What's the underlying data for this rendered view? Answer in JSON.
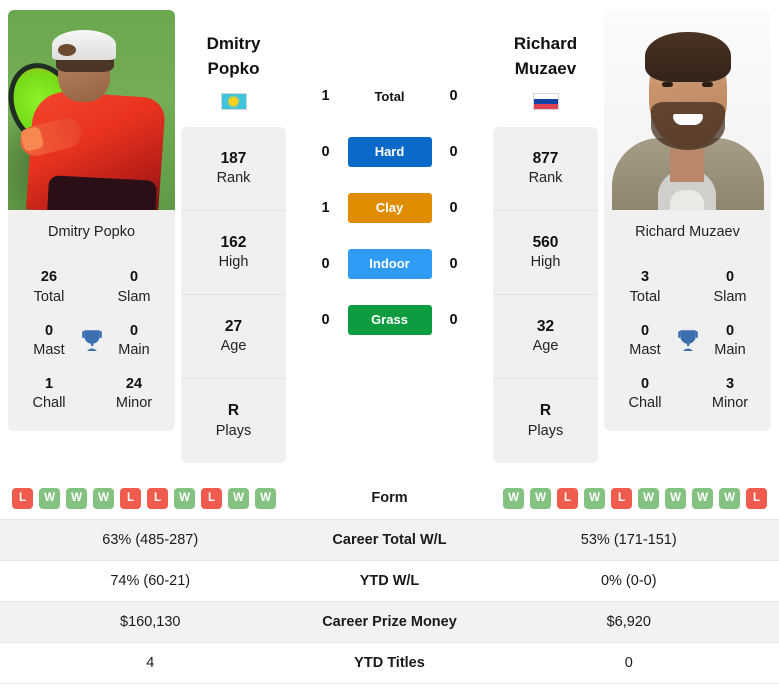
{
  "players": {
    "left": {
      "first_name": "Dmitry",
      "last_name": "Popko",
      "photo_caption": "Dmitry Popko",
      "country_code": "KZ",
      "flag_icon": "kazakhstan-flag-icon",
      "stats": [
        {
          "value": "187",
          "label": "Rank"
        },
        {
          "value": "162",
          "label": "High"
        },
        {
          "value": "27",
          "label": "Age"
        },
        {
          "value": "R",
          "label": "Plays"
        }
      ],
      "titles": [
        {
          "value": "26",
          "label": "Total"
        },
        {
          "value": "0",
          "label": "Slam"
        },
        {
          "value": "0",
          "label": "Mast"
        },
        {
          "value": "0",
          "label": "Main"
        },
        {
          "value": "1",
          "label": "Chall"
        },
        {
          "value": "24",
          "label": "Minor"
        }
      ],
      "form": [
        "L",
        "W",
        "W",
        "W",
        "L",
        "L",
        "W",
        "L",
        "W",
        "W"
      ],
      "career_total_wl": "63% (485-287)",
      "ytd_wl": "74% (60-21)",
      "career_prize_money": "$160,130",
      "ytd_titles": "4"
    },
    "right": {
      "first_name": "Richard",
      "last_name": "Muzaev",
      "photo_caption": "Richard Muzaev",
      "country_code": "RU",
      "flag_icon": "russia-flag-icon",
      "stats": [
        {
          "value": "877",
          "label": "Rank"
        },
        {
          "value": "560",
          "label": "High"
        },
        {
          "value": "32",
          "label": "Age"
        },
        {
          "value": "R",
          "label": "Plays"
        }
      ],
      "titles": [
        {
          "value": "3",
          "label": "Total"
        },
        {
          "value": "0",
          "label": "Slam"
        },
        {
          "value": "0",
          "label": "Mast"
        },
        {
          "value": "0",
          "label": "Main"
        },
        {
          "value": "0",
          "label": "Chall"
        },
        {
          "value": "3",
          "label": "Minor"
        }
      ],
      "form": [
        "W",
        "W",
        "L",
        "W",
        "L",
        "W",
        "W",
        "W",
        "W",
        "L"
      ],
      "career_total_wl": "53% (171-151)",
      "ytd_wl": "0% (0-0)",
      "career_prize_money": "$6,920",
      "ytd_titles": "0"
    }
  },
  "head_to_head": [
    {
      "label": "Total",
      "left": "1",
      "right": "0",
      "style": "plain",
      "color": ""
    },
    {
      "label": "Hard",
      "left": "0",
      "right": "0",
      "style": "badge",
      "color": "#0b69c7"
    },
    {
      "label": "Clay",
      "left": "1",
      "right": "0",
      "style": "badge",
      "color": "#e08c00"
    },
    {
      "label": "Indoor",
      "left": "0",
      "right": "0",
      "style": "badge",
      "color": "#2f9bf5"
    },
    {
      "label": "Grass",
      "left": "0",
      "right": "0",
      "style": "badge",
      "color": "#0d9c3f"
    }
  ],
  "table": {
    "rows": [
      {
        "label": "Form",
        "key": "form",
        "type": "form"
      },
      {
        "label": "Career Total W/L",
        "key": "career_total_wl",
        "type": "text"
      },
      {
        "label": "YTD W/L",
        "key": "ytd_wl",
        "type": "text"
      },
      {
        "label": "Career Prize Money",
        "key": "career_prize_money",
        "type": "text"
      },
      {
        "label": "YTD Titles",
        "key": "ytd_titles",
        "type": "text"
      }
    ]
  },
  "colors": {
    "win_badge": "#83c281",
    "loss_badge": "#ef5b4c",
    "card_bg": "#f0f0f0",
    "row_shaded": "#f2f2f2",
    "trophy": "#3b6fb0"
  },
  "icons": {
    "trophy": "trophy-icon"
  }
}
